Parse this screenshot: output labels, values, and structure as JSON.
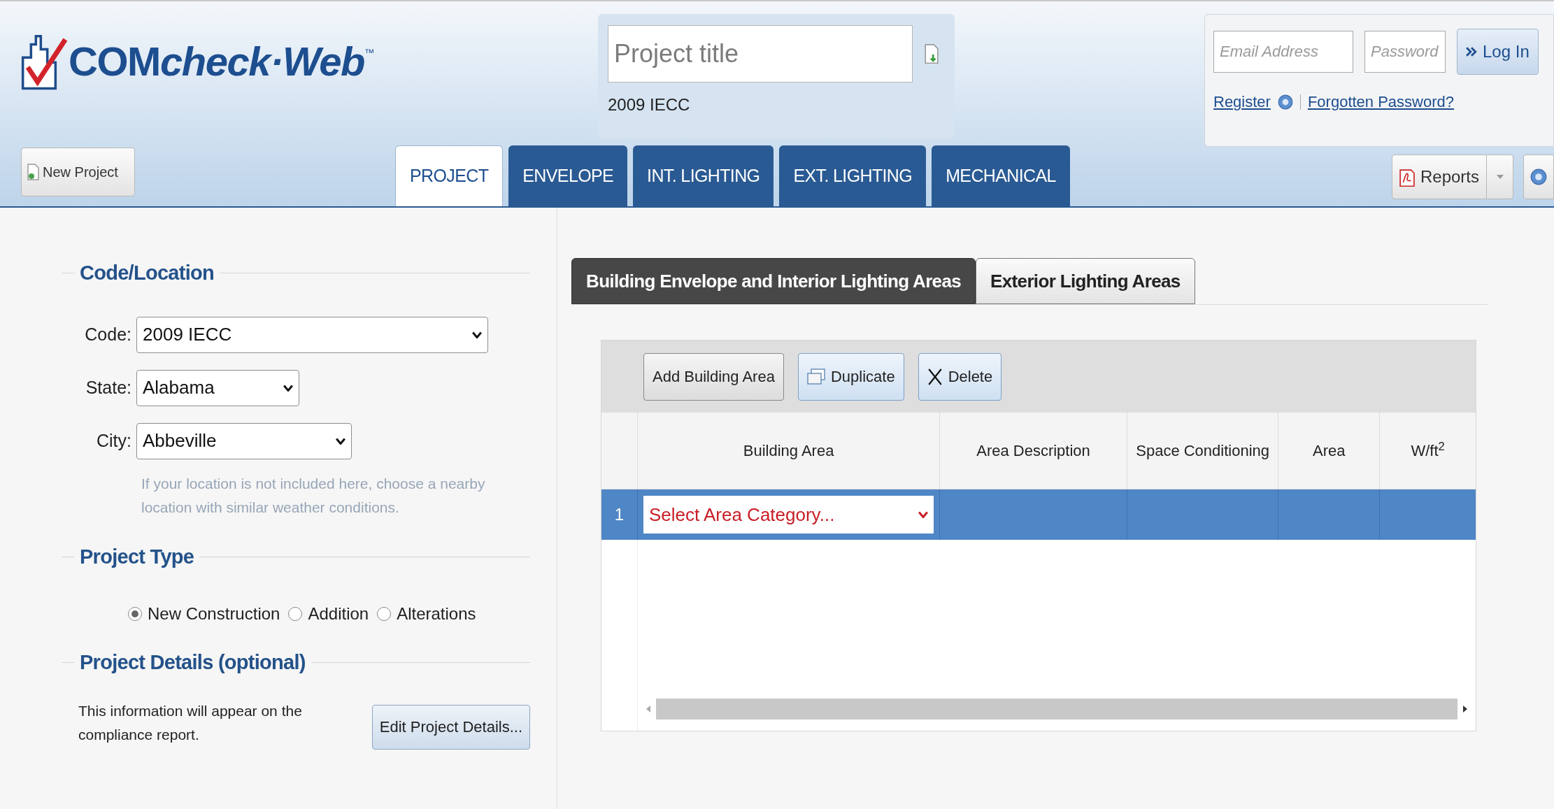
{
  "header": {
    "logo": {
      "bold": "COM",
      "italic": "check·Web",
      "trademark": "™"
    },
    "project_title": {
      "placeholder": "Project title"
    },
    "code_caption": "2009 IECC",
    "login": {
      "email": {
        "placeholder": "Email Address"
      },
      "password": {
        "placeholder": "Password"
      },
      "button": "Log In",
      "register": "Register",
      "forgotten": "Forgotten Password?"
    }
  },
  "toolbar": {
    "new_project": "New Project",
    "tabs": [
      {
        "label": "PROJECT",
        "selected": true
      },
      {
        "label": "ENVELOPE",
        "selected": false
      },
      {
        "label": "INT. LIGHTING",
        "selected": false
      },
      {
        "label": "EXT. LIGHTING",
        "selected": false
      },
      {
        "label": "MECHANICAL",
        "selected": false
      }
    ],
    "reports": "Reports"
  },
  "left": {
    "code_location": {
      "heading": "Code/Location",
      "fields": [
        {
          "label": "Code:",
          "value": "2009 IECC",
          "kind": "wide"
        },
        {
          "label": "State:",
          "value": "Alabama",
          "kind": "short"
        },
        {
          "label": "City:",
          "value": "Abbeville",
          "kind": "medium"
        }
      ],
      "hint": "If your location is not included here, choose a nearby location with similar weather conditions."
    },
    "project_type": {
      "heading": "Project Type",
      "options": [
        {
          "label": "New Construction",
          "selected": true
        },
        {
          "label": "Addition",
          "selected": false
        },
        {
          "label": "Alterations",
          "selected": false
        }
      ]
    },
    "project_details": {
      "heading": "Project Details (optional)",
      "text": "This information will appear on the compliance report.",
      "button": "Edit Project Details..."
    }
  },
  "right": {
    "subtabs": [
      {
        "label": "Building Envelope and Interior Lighting Areas",
        "selected": true
      },
      {
        "label": "Exterior Lighting Areas",
        "selected": false
      }
    ],
    "buttons": [
      {
        "label": "Add Building Area",
        "kind": "plain"
      },
      {
        "label": "Duplicate",
        "kind": "duplicate"
      },
      {
        "label": "Delete",
        "kind": "delete"
      }
    ],
    "table": {
      "columns": [
        "Building Area",
        "Area Description",
        "Space Conditioning",
        "Area",
        "W/ft$^{2}$"
      ],
      "rows": [
        {
          "number": "1",
          "building_area": {
            "placeholder": "Select Area Category..."
          },
          "selected": true
        }
      ]
    }
  }
}
